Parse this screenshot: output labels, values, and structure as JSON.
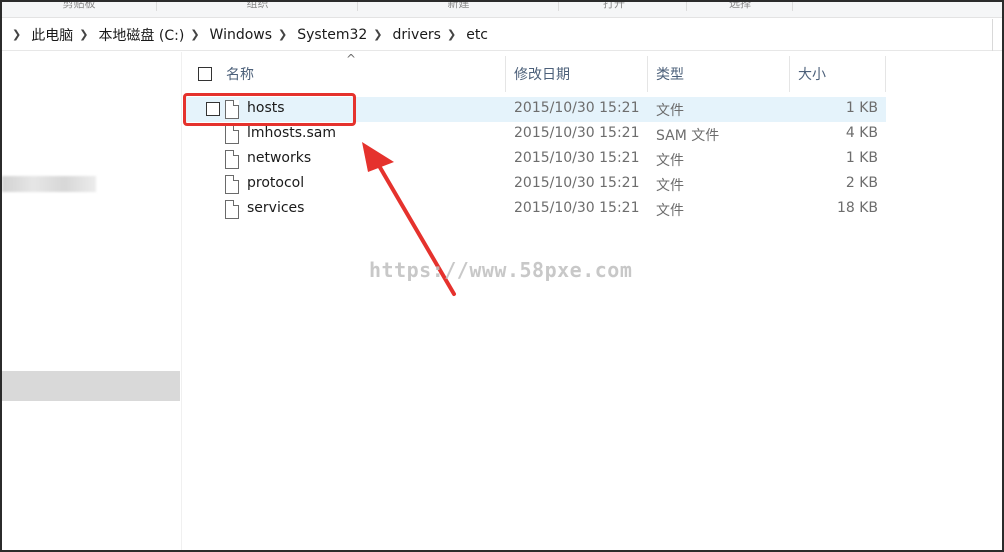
{
  "ribbon": {
    "groups": [
      "剪贴板",
      "组织",
      "新建",
      "打开",
      "选择"
    ]
  },
  "address_bar": {
    "segments": [
      "此电脑",
      "本地磁盘 (C:)",
      "Windows",
      "System32",
      "drivers",
      "etc"
    ]
  },
  "file_list": {
    "columns": {
      "name": "名称",
      "date": "修改日期",
      "type": "类型",
      "size": "大小"
    },
    "sort_indicator": "^",
    "rows": [
      {
        "name": "hosts",
        "date": "2015/10/30 15:21",
        "type": "文件",
        "size": "1 KB",
        "highlighted": true
      },
      {
        "name": "lmhosts.sam",
        "date": "2015/10/30 15:21",
        "type": "SAM 文件",
        "size": "4 KB"
      },
      {
        "name": "networks",
        "date": "2015/10/30 15:21",
        "type": "文件",
        "size": "1 KB"
      },
      {
        "name": "protocol",
        "date": "2015/10/30 15:21",
        "type": "文件",
        "size": "2 KB"
      },
      {
        "name": "services",
        "date": "2015/10/30 15:21",
        "type": "文件",
        "size": "18 KB"
      }
    ]
  },
  "annotation": {
    "color": "#e5322d"
  },
  "watermark": {
    "text": "https://www.58pxe.com"
  },
  "colors": {
    "selection": "#e5f3fb",
    "header_text": "#4c607a",
    "nav_selected": "#d9d9d9"
  }
}
